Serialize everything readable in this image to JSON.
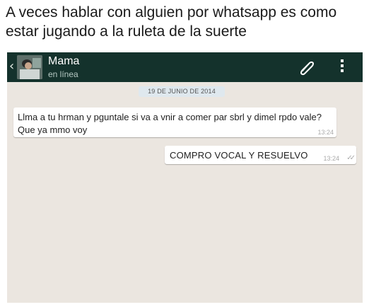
{
  "caption": "A veces hablar con alguien por whatsapp es como estar jugando a la ruleta de la suerte",
  "header": {
    "contact_name": "Mama",
    "status": "en línea",
    "icons": [
      "back-arrow-icon",
      "avatar",
      "paperclip-icon",
      "menu-dots-icon"
    ],
    "background_color": "#14322c"
  },
  "chat": {
    "background_color": "#ebe6e0",
    "date": "19 DE JUNIO DE 2014",
    "messages": [
      {
        "direction": "incoming",
        "text": "Llma a tu hrman y pguntale si va a vnir a comer par sbrl y dimel rpdo vale? Que ya mmo voy",
        "time": "13:24"
      },
      {
        "direction": "outgoing",
        "text": "COMPRO VOCAL Y RESUELVO",
        "time": "13:24",
        "status_icon": "double-check-icon"
      }
    ]
  }
}
